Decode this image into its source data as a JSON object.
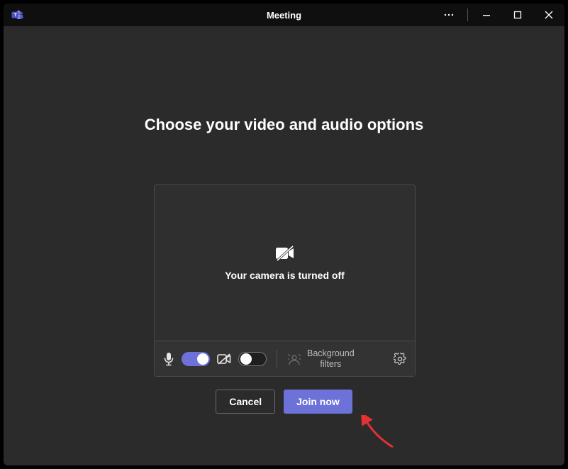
{
  "titlebar": {
    "title": "Meeting"
  },
  "heading": "Choose your video and audio options",
  "preview": {
    "camera_off_message": "Your camera is turned off"
  },
  "toolbar": {
    "mic_on": true,
    "camera_on": false,
    "background_filters_label_line1": "Background",
    "background_filters_label_line2": "filters"
  },
  "actions": {
    "cancel": "Cancel",
    "join": "Join now"
  },
  "colors": {
    "accent": "#6d72d8",
    "window_bg": "#2b2b2b"
  }
}
